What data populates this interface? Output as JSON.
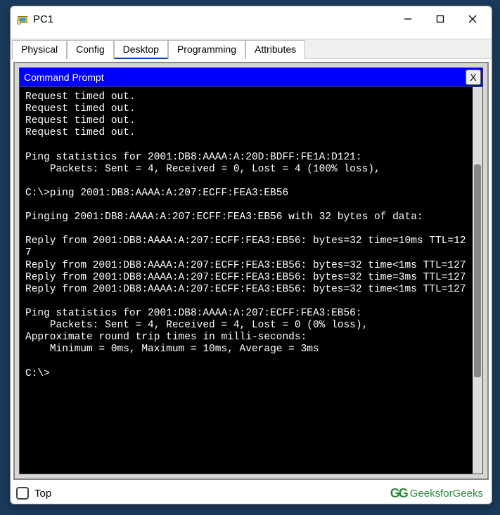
{
  "window": {
    "title": "PC1"
  },
  "tabs": [
    {
      "label": "Physical",
      "active": false
    },
    {
      "label": "Config",
      "active": false
    },
    {
      "label": "Desktop",
      "active": true
    },
    {
      "label": "Programming",
      "active": false
    },
    {
      "label": "Attributes",
      "active": false
    }
  ],
  "panel": {
    "title": "Command Prompt",
    "close_label": "X"
  },
  "terminal_lines": [
    "Request timed out.",
    "Request timed out.",
    "Request timed out.",
    "Request timed out.",
    "",
    "Ping statistics for 2001:DB8:AAAA:A:20D:BDFF:FE1A:D121:",
    "    Packets: Sent = 4, Received = 0, Lost = 4 (100% loss),",
    "",
    "C:\\>ping 2001:DB8:AAAA:A:207:ECFF:FEA3:EB56",
    "",
    "Pinging 2001:DB8:AAAA:A:207:ECFF:FEA3:EB56 with 32 bytes of data:",
    "",
    "Reply from 2001:DB8:AAAA:A:207:ECFF:FEA3:EB56: bytes=32 time=10ms TTL=127",
    "Reply from 2001:DB8:AAAA:A:207:ECFF:FEA3:EB56: bytes=32 time<1ms TTL=127",
    "Reply from 2001:DB8:AAAA:A:207:ECFF:FEA3:EB56: bytes=32 time=3ms TTL=127",
    "Reply from 2001:DB8:AAAA:A:207:ECFF:FEA3:EB56: bytes=32 time<1ms TTL=127",
    "",
    "Ping statistics for 2001:DB8:AAAA:A:207:ECFF:FEA3:EB56:",
    "    Packets: Sent = 4, Received = 4, Lost = 0 (0% loss),",
    "Approximate round trip times in milli-seconds:",
    "    Minimum = 0ms, Maximum = 10ms, Average = 3ms",
    "",
    "C:\\>"
  ],
  "footer": {
    "checkbox_label": "Top"
  },
  "watermark": {
    "logo": "GG",
    "text": "GeeksforGeeks"
  }
}
